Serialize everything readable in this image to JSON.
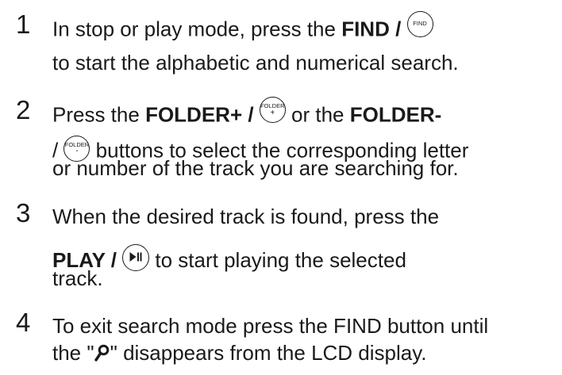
{
  "steps": [
    {
      "number": "1",
      "lines": [
        {
          "a": "In stop or play mode, press the ",
          "b": "FIND /",
          "icon_label": "FIND"
        },
        {
          "text": "to start the alphabetic and numerical search."
        }
      ]
    },
    {
      "number": "2",
      "lines": [
        {
          "a": "Press the ",
          "b1": "FOLDER+ /",
          "icon1_label": "FOLDER",
          "icon1_sign": "+",
          "c": " or the ",
          "b2": "FOLDER-"
        },
        {
          "a": "/ ",
          "icon2_label": "FOLDER",
          "icon2_sign": "-",
          "c": " buttons to select the corresponding letter"
        },
        {
          "text": "or number of the track you are searching for."
        }
      ]
    },
    {
      "number": "3",
      "lines": [
        {
          "text": "When the desired track is found, press the"
        },
        {
          "b": "PLAY /",
          "icon_name": "play-pause-icon",
          "c": " to start playing the selected"
        },
        {
          "text": "track."
        }
      ]
    },
    {
      "number": "4",
      "lines": [
        {
          "text": "To exit search mode press the FIND button until"
        },
        {
          "a": "the \"",
          "icon_name": "search-icon",
          "c": "\" disappears from the LCD display."
        }
      ]
    }
  ]
}
